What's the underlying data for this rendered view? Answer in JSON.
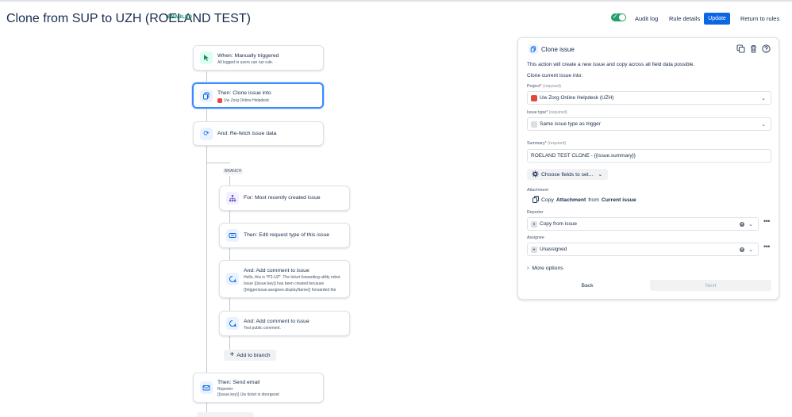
{
  "header": {
    "title": "Clone from SUP to UZH (ROELAND TEST)",
    "status_badge": "ENABLED",
    "enabled": true,
    "audit_log": "Audit log",
    "rule_details": "Rule details",
    "update": "Update",
    "return_to_rules": "Return to rules"
  },
  "flow": {
    "trigger": {
      "title": "When: Manually triggered",
      "subtitle": "All logged in users can run rule.",
      "icon": "cursor-click-icon"
    },
    "clone": {
      "title": "Then: Clone issue into",
      "subtitle": "Uw Zorg Online Helpdesk",
      "icon": "copy-icon"
    },
    "refetch": {
      "title": "And: Re-fetch issue data",
      "icon": "refresh-icon"
    },
    "branch_label": "BRANCH",
    "branch_for": {
      "title": "For: Most recently created issue",
      "icon": "branch-icon"
    },
    "edit_request": {
      "title": "Then: Edit request type of this issue",
      "icon": "edit-icon"
    },
    "comment1": {
      "title": "And: Add comment to issue",
      "line1": "Hello, this is *P2-UZ*. The ticket forwarding utility robot.",
      "line2": "Issue {{issue.key}} has been created because",
      "line3": "{{triggerIssue.assignee.displayName}} forwarded the",
      "icon": "comment-icon"
    },
    "comment2": {
      "title": "And: Add comment to issue",
      "subtitle": "Test public comment.",
      "icon": "comment-icon"
    },
    "add_to_branch": "Add to branch",
    "send_email": {
      "title": "Then: Send email",
      "line1": "Reporter",
      "line2": "{{issue.key}} Uw ticket is doorgezet",
      "icon": "mail-icon"
    }
  },
  "panel": {
    "title": "Clone issue",
    "description": "This action will create a new issue and copy across all field data possible.",
    "clone_into": "Clone current issue into:",
    "project_label": "Project",
    "required": "(required)",
    "project_value": "Uw Zorg Online Helpdesk (UZH)",
    "issue_type_label": "Issue type",
    "issue_type_value": "Same issue type as trigger",
    "summary_label": "Summary",
    "summary_value": "ROELAND TEST CLONE - {{issue.summary}}",
    "choose_fields": "Choose fields to set...",
    "attachment_label": "Attachment",
    "attachment_copy": "Copy",
    "attachment_word": "Attachment",
    "attachment_from": "from",
    "attachment_source": "Current issue",
    "reporter_label": "Reporter",
    "reporter_value": "Copy from issue",
    "assignee_label": "Assignee",
    "assignee_value": "Unassigned",
    "more_options": "More options",
    "back": "Back",
    "next": "Next"
  },
  "colors": {
    "primary": "#0c66e4",
    "enabled": "#00875a",
    "selected_border": "#388bff"
  }
}
